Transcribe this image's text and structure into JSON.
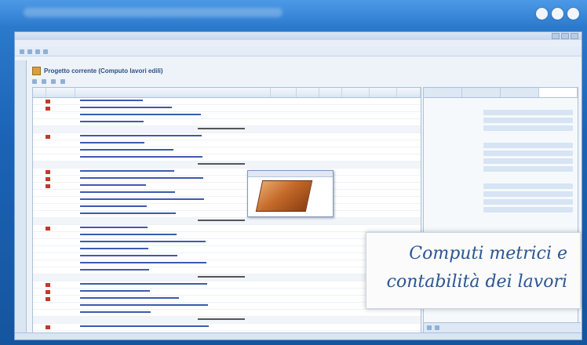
{
  "frame": {
    "dots": [
      "dot-1",
      "dot-2",
      "dot-3"
    ]
  },
  "app": {
    "document_title": "Progetto corrente (Computo lavori edili)"
  },
  "callout": {
    "line1": "Computi metrici e",
    "line2": "contabilità dei lavori"
  },
  "colors": {
    "frame_blue": "#1f6ac2",
    "accent_text": "#2a5591",
    "row_link": "#3352a3",
    "tag_red": "#c0392b"
  },
  "icons": [
    "window-dot-icon",
    "document-icon",
    "tile-preview-icon"
  ]
}
